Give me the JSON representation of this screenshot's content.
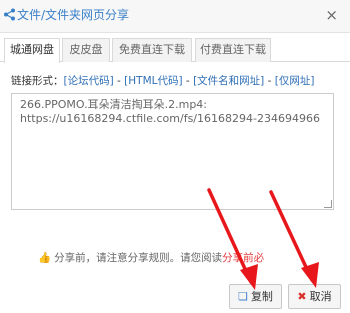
{
  "dialog": {
    "title": "文件/文件夹网页分享",
    "close_glyph": "×"
  },
  "tabs": [
    {
      "label": "城通网盘",
      "active": true
    },
    {
      "label": "皮皮盘",
      "active": false
    },
    {
      "label": "免费直连下载",
      "active": false
    },
    {
      "label": "付费直连下载",
      "active": false
    }
  ],
  "link_format": {
    "label": "链接形式：",
    "options": [
      "[论坛代码]",
      "[HTML代码]",
      "[文件名和网址]",
      "[仅网址]"
    ],
    "separator": " - "
  },
  "share_text": {
    "line1": "266.PPOMO.耳朵清洁掏耳朵.2.mp4:",
    "line2": "https://u16168294.ctfile.com/fs/16168294-234694966"
  },
  "notice": {
    "thumb_glyph": "👍",
    "text": "分享前，请注意分享规则。请您阅读",
    "rules_link": "分享前必"
  },
  "buttons": {
    "copy": "复制",
    "cancel": "取消"
  },
  "colors": {
    "accent": "#3a7fc8",
    "link": "#2f6fb6",
    "arrow": "#e8171b",
    "warning": "#e4393c"
  },
  "icons": {
    "title": "share-icon",
    "close": "close-icon",
    "copy": "copy-icon",
    "cancel": "x-icon",
    "notice": "thumbs-up-icon"
  }
}
